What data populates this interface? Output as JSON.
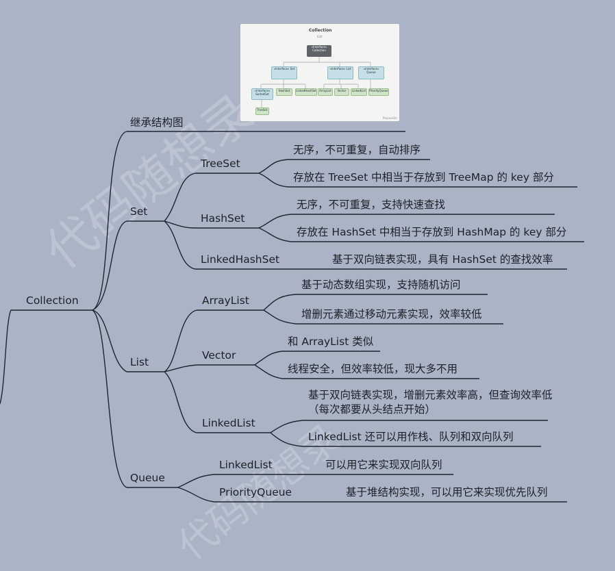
{
  "root": {
    "label": "Collection"
  },
  "inheritance": {
    "label": "继承结构图"
  },
  "thumbnail": {
    "title": "Collection",
    "subtitle": "Edit",
    "root": "«Interface» Collection",
    "interfaces": [
      "«Interface» Set",
      "«Interface» List",
      "«Interface» Queue"
    ],
    "sorted": "«Interface» SortedSet",
    "classes": [
      "HashSet",
      "LinkedHashSet",
      "ArrayList",
      "Vector",
      "LinkedList",
      "PriorityQueue"
    ],
    "treeset": "TreeSet",
    "brand": "ProcessOn"
  },
  "set": {
    "label": "Set",
    "treeset": {
      "label": "TreeSet",
      "notes": [
        "无序，不可重复，自动排序",
        "存放在 TreeSet 中相当于存放到 TreeMap 的 key 部分"
      ]
    },
    "hashset": {
      "label": "HashSet",
      "notes": [
        "无序，不可重复，支持快速查找",
        "存放在 HashSet 中相当于存放到 HashMap 的 key 部分"
      ]
    },
    "linkedhashset": {
      "label": "LinkedHashSet",
      "notes": [
        "基于双向链表实现，具有 HashSet 的查找效率"
      ]
    }
  },
  "list": {
    "label": "List",
    "arraylist": {
      "label": "ArrayList",
      "notes": [
        "基于动态数组实现，支持随机访问",
        "增删元素通过移动元素实现，效率较低"
      ]
    },
    "vector": {
      "label": "Vector",
      "notes": [
        "和 ArrayList 类似",
        "线程安全，但效率较低，现大多不用"
      ]
    },
    "linkedlist": {
      "label": "LinkedList",
      "notes": [
        "基于双向链表实现，增删元素效率高，但查询效率低（每次都要从头结点开始）",
        "LinkedList 还可以用作栈、队列和双向队列"
      ]
    }
  },
  "queue": {
    "label": "Queue",
    "linkedlist": {
      "label": "LinkedList",
      "notes": [
        "可以用它来实现双向队列"
      ]
    },
    "priorityqueue": {
      "label": "PriorityQueue",
      "notes": [
        "基于堆结构实现，可以用它来实现优先队列"
      ]
    }
  },
  "watermarks": [
    "代码随想录",
    "代码随想录"
  ],
  "colors": {
    "background": "#aab4c5",
    "line": "#1e2430"
  }
}
